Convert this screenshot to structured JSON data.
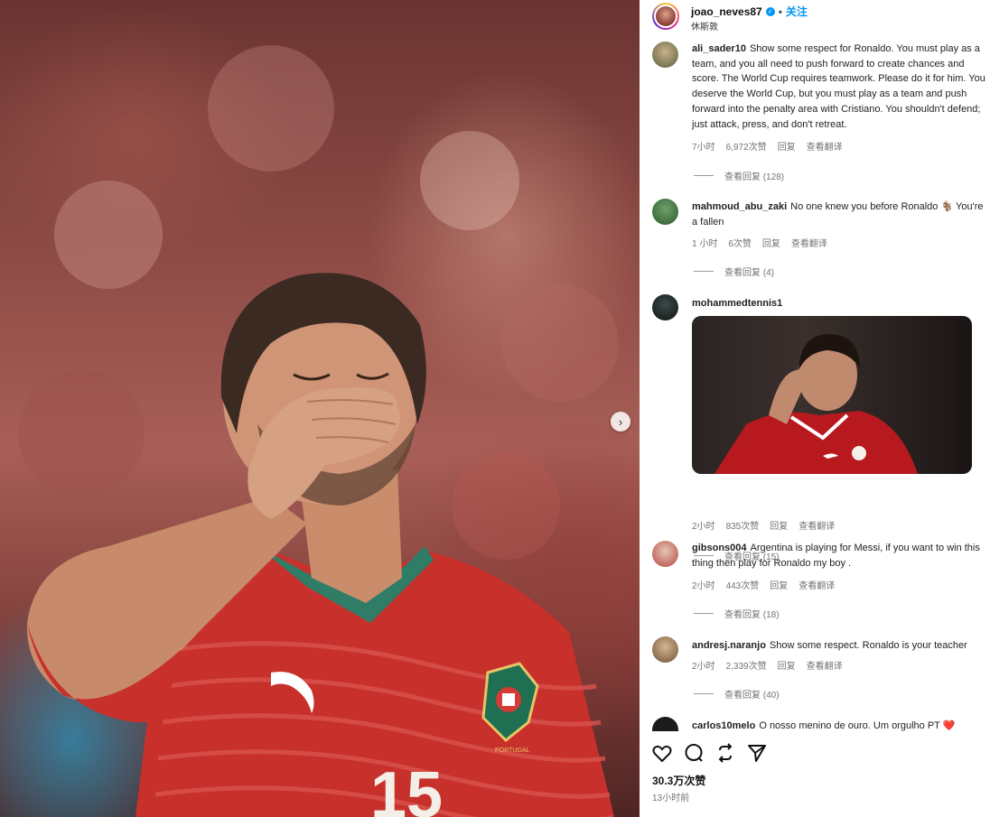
{
  "header": {
    "username": "joao_neves87",
    "separator": "•",
    "follow_label": "关注",
    "subtitle": "休斯敦"
  },
  "comments": [
    {
      "username": "ali_sader10",
      "text": "Show some respect for Ronaldo. You must play as a team, and you all need to push forward to create chances and score. The World Cup requires teamwork. Please do it for him. You deserve the World Cup, but you must play as a team and push forward into the penalty area with Cristiano. You shouldn't defend; just attack, press, and don't retreat.",
      "time": "7小时",
      "likes": "6,972次赞",
      "reply": "回复",
      "translate": "查看翻译",
      "view_replies": "查看回复 (128)"
    },
    {
      "username": "mahmoud_abu_zaki",
      "text": "No one knew you before Ronaldo 🐐 You're a fallen",
      "time": "1 小时",
      "likes": "6次赞",
      "reply": "回复",
      "translate": "查看翻译",
      "view_replies": "查看回复 (4)"
    },
    {
      "username": "mohammedtennis1",
      "text": "",
      "time": "2小时",
      "likes": "835次赞",
      "reply": "回复",
      "translate": "查看翻译",
      "view_replies": "查看回复 (15)"
    },
    {
      "username": "gibsons004",
      "text": "Argentina is playing for Messi, if you want to win this thing then play for Ronaldo my boy .",
      "time": "2小时",
      "likes": "443次赞",
      "reply": "回复",
      "translate": "查看翻译",
      "view_replies": "查看回复 (18)"
    },
    {
      "username": "andresj.naranjo",
      "text": "Show some respect. Ronaldo is your teacher",
      "time": "2小时",
      "likes": "2,339次赞",
      "reply": "回复",
      "translate": "查看翻译",
      "view_replies": "查看回复 (40)"
    },
    {
      "username": "carlos10melo",
      "text": "O nosso menino de ouro. Um orgulho PT ❤️"
    }
  ],
  "photo": {
    "jersey_number": "15",
    "crest_text": "PORTUGAL"
  },
  "footer": {
    "likes": "30.3万次赞",
    "time": "13小时前"
  },
  "icons": {
    "like": "heart-icon",
    "comment": "comment-icon",
    "share": "share-icon",
    "send": "send-icon",
    "next": "chevron-right-icon"
  },
  "colors": {
    "accent": "#0095f6",
    "meta_text": "#737373",
    "jersey_red": "#c8302c"
  }
}
